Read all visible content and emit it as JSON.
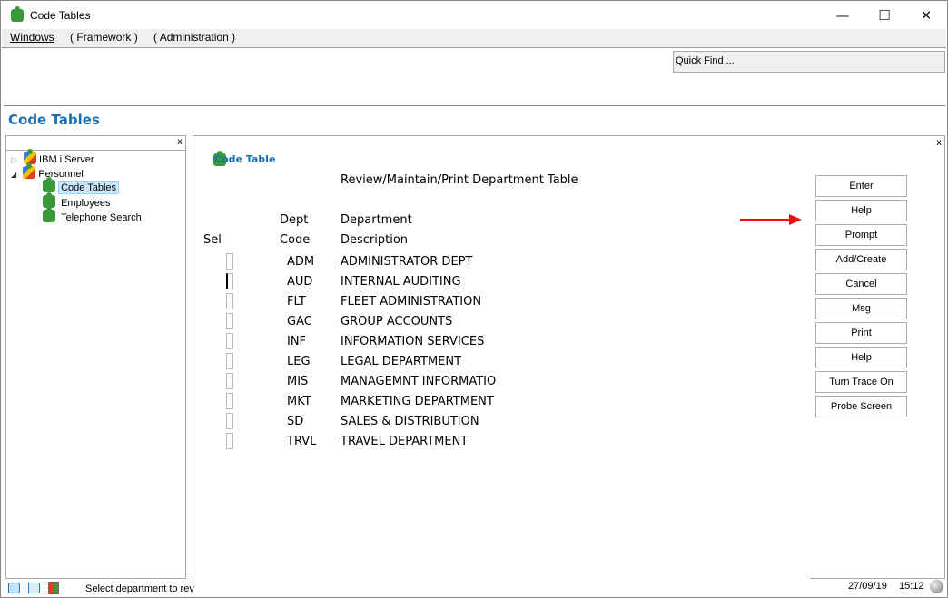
{
  "window": {
    "title": "Code Tables",
    "minimize": "—",
    "maximize": "☐",
    "close": "✕"
  },
  "menu": [
    "Windows",
    "( Framework )",
    "( Administration )"
  ],
  "quick_find": "Quick Find ...",
  "page_title": "Code Tables",
  "tree": {
    "close": "x",
    "items": [
      {
        "label": "IBM i Server",
        "expander": "▷"
      },
      {
        "label": "Personnel",
        "expander": "◢"
      },
      {
        "label": "Code Tables",
        "selected": true
      },
      {
        "label": "Employees"
      },
      {
        "label": "Telephone Search"
      }
    ]
  },
  "panel": {
    "close": "x",
    "title": "Code Table",
    "heading": "Review/Maintain/Print Department Table",
    "headers": {
      "sel": "Sel",
      "dept": "Dept",
      "code": "Code",
      "department": "Department",
      "description": "Description"
    },
    "rows": [
      {
        "code": "ADM",
        "desc": "ADMINISTRATOR DEPT"
      },
      {
        "code": "AUD",
        "desc": "INTERNAL AUDITING"
      },
      {
        "code": "FLT",
        "desc": "FLEET ADMINISTRATION"
      },
      {
        "code": "GAC",
        "desc": "GROUP ACCOUNTS"
      },
      {
        "code": "INF",
        "desc": "INFORMATION SERVICES"
      },
      {
        "code": "LEG",
        "desc": "LEGAL DEPARTMENT"
      },
      {
        "code": "MIS",
        "desc": "MANAGEMNT INFORMATIO"
      },
      {
        "code": "MKT",
        "desc": "MARKETING DEPARTMENT"
      },
      {
        "code": "SD",
        "desc": "SALES & DISTRIBUTION"
      },
      {
        "code": "TRVL",
        "desc": "TRAVEL DEPARTMENT"
      }
    ],
    "buttons": [
      "Enter",
      "Help",
      "Prompt",
      "Add/Create",
      "Cancel",
      "Msg",
      "Print",
      "Help",
      "Turn Trace On",
      "Probe Screen"
    ]
  },
  "status": {
    "message": "Select department to rev",
    "date": "27/09/19",
    "time": "15:12"
  },
  "colors": {
    "accent": "#1a6fb5",
    "arrow": "#e81010"
  }
}
